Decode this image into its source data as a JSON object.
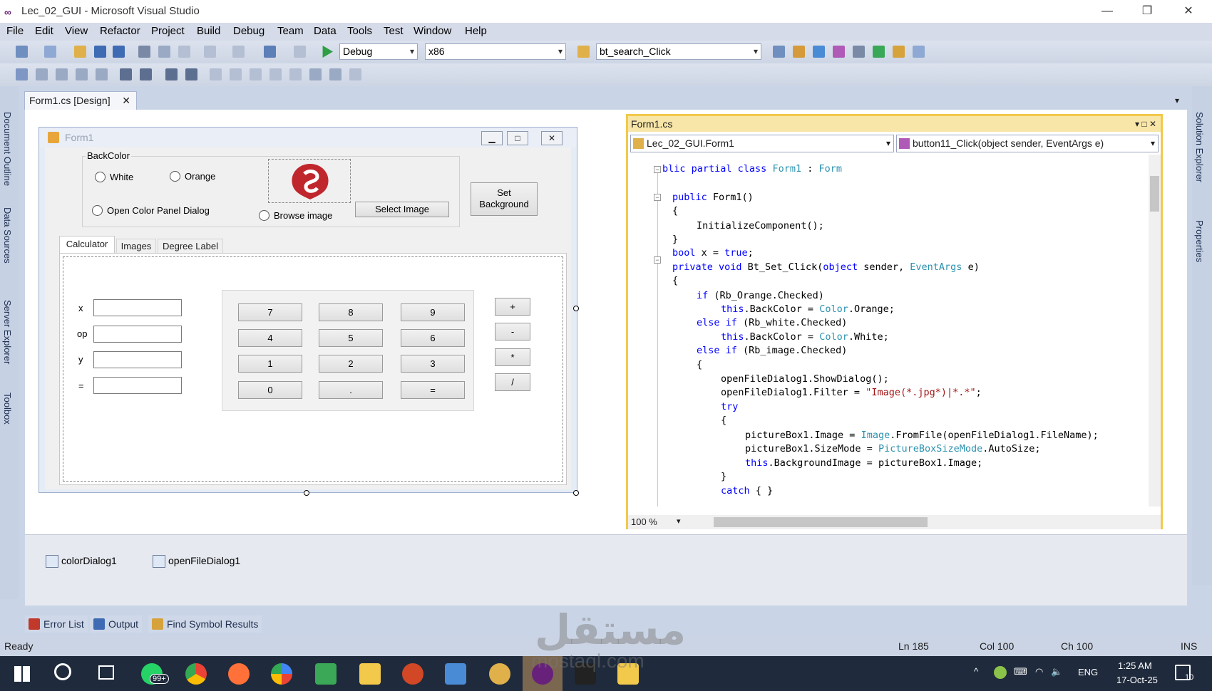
{
  "window": {
    "title": "Lec_02_GUI - Microsoft Visual Studio",
    "logo": "∞",
    "min": "—",
    "max": "❐",
    "close": "✕"
  },
  "menu": [
    "File",
    "Edit",
    "View",
    "Refactor",
    "Project",
    "Build",
    "Debug",
    "Team",
    "Data",
    "Tools",
    "Test",
    "Window",
    "Help"
  ],
  "toolbar": {
    "config": "Debug",
    "platform": "x86",
    "find": "bt_search_Click"
  },
  "left_rail": [
    "Document Outline",
    "Data Sources",
    "Server Explorer",
    "Toolbox"
  ],
  "right_rail": [
    "Solution Explorer",
    "Properties"
  ],
  "doc_tab": {
    "label": "Form1.cs [Design]",
    "close": "✕"
  },
  "form1": {
    "title": "Form1",
    "backcolor_group": "BackColor",
    "radio_white": "White",
    "radio_orange": "Orange",
    "radio_panel": "Open Color Panel Dialog",
    "radio_browse": "Browse image",
    "select_image": "Select Image",
    "set_bg": "Set Background",
    "tabs": [
      "Calculator",
      "Images",
      "Degree Label"
    ],
    "labels": [
      "x",
      "op",
      "y",
      "="
    ],
    "keys": [
      "7",
      "8",
      "9",
      "4",
      "5",
      "6",
      "1",
      "2",
      "3",
      "0",
      ".",
      "="
    ],
    "ops": [
      "+",
      "-",
      "*",
      "/"
    ]
  },
  "codewin": {
    "title": "Form1.cs",
    "class_drop": "Lec_02_GUI.Form1",
    "member_drop": "button11_Click(object sender, EventArgs e)",
    "zoom": "100 %",
    "controls": "▾ □ ✕"
  },
  "tray": {
    "color_dialog": "colorDialog1",
    "file_dialog": "openFileDialog1"
  },
  "bottom_tabs": [
    "Error List",
    "Output",
    "Find Symbol Results"
  ],
  "status": {
    "ready": "Ready",
    "ln": "Ln 185",
    "col": "Col 100",
    "ch": "Ch 100",
    "ins": "INS"
  },
  "taskbar": {
    "badge": "99+",
    "lang": "ENG",
    "time": "1:25 AM",
    "date": "17-Oct-25",
    "notif": "10"
  },
  "watermark": {
    "ar": "مستقل",
    "en": "mostaql.com"
  }
}
